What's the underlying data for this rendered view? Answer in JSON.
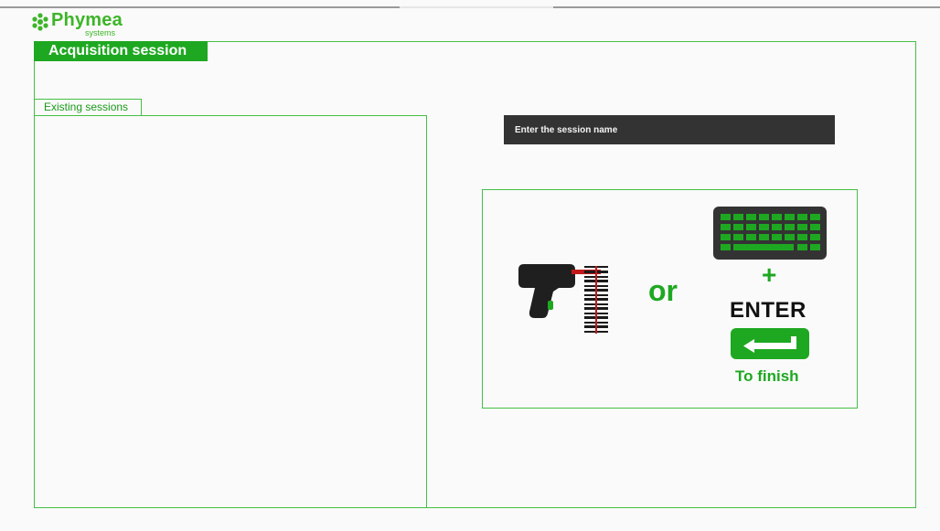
{
  "logo": {
    "name": "Phymea",
    "subtitle": "systems"
  },
  "session": {
    "title": "Acquisition session",
    "existing_tab": "Existing sessions",
    "existing_items": [],
    "input_placeholder": "Enter the session name",
    "input_value": ""
  },
  "instructions": {
    "or_label": "or",
    "plus_label": "+",
    "enter_label": "ENTER",
    "finish_label": "To finish"
  },
  "colors": {
    "accent": "#1ea821",
    "input_bg": "#333333",
    "keyboard_bg": "#333333"
  },
  "icons": [
    "barcode-scanner-icon",
    "keyboard-icon",
    "enter-key-icon",
    "logo-icon"
  ]
}
